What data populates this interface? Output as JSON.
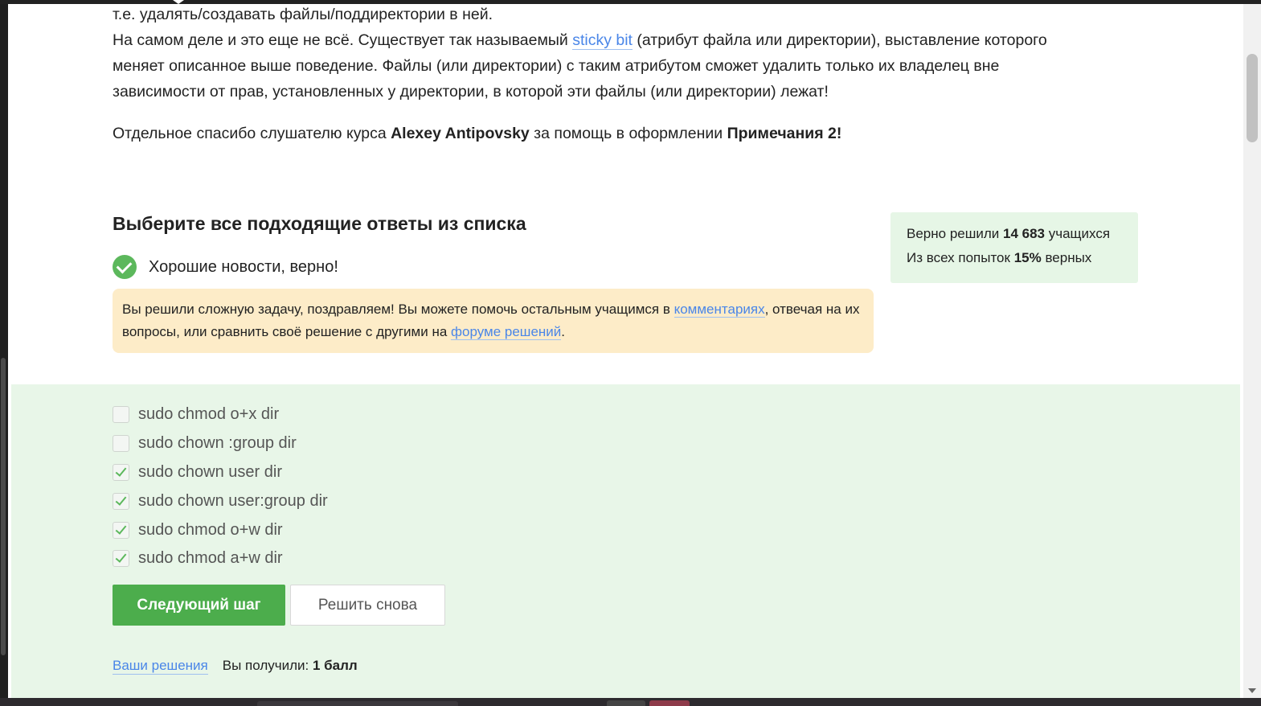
{
  "content": {
    "para1_line1": "т.е. удалять/создавать файлы/поддиректории в ней.",
    "para1_line2_before": "На самом деле и это еще не всё. Существует так называемый ",
    "sticky_bit_link": "sticky bit",
    "para1_line2_after": " (атрибут файла или директории), выставление которого",
    "para1_line3": "меняет описанное выше поведение. Файлы (или директории) с таким атрибутом сможет удалить только их владелец вне",
    "para1_line4": "зависимости от прав, установленных у директории, в которой эти файлы (или директории) лежат!",
    "thanks_before": "Отдельное спасибо слушателю курса ",
    "thanks_name": "Alexey Antipovsky",
    "thanks_middle": " за помощь в оформлении ",
    "thanks_note": "Примечания 2!"
  },
  "quiz": {
    "title": "Выберите все подходящие ответы из списка",
    "good_news": "Хорошие новости, верно!",
    "notice_before": "Вы решили сложную задачу, поздравляем! Вы можете помочь остальным учащимся в ",
    "notice_link_comments": "комментариях",
    "notice_middle": ", отвечая на их вопросы, или сравнить своё решение с другими на ",
    "notice_link_forum": "форуме решений",
    "notice_end": ".",
    "options": [
      {
        "label": "sudo chmod o+x dir",
        "checked": false
      },
      {
        "label": "sudo chown :group dir",
        "checked": false
      },
      {
        "label": "sudo chown user dir",
        "checked": true
      },
      {
        "label": "sudo chown user:group dir",
        "checked": true
      },
      {
        "label": "sudo chmod o+w dir",
        "checked": true
      },
      {
        "label": "sudo chmod a+w dir",
        "checked": true
      }
    ],
    "next_button": "Следующий шаг",
    "retry_button": "Решить снова",
    "your_solutions_link": "Ваши решения",
    "score_label": "Вы получили: ",
    "score_value": "1 балл"
  },
  "stats": {
    "solved_label": "Верно решили ",
    "solved_count": "14 683",
    "solved_suffix": " учащихся",
    "attempts_label": "Из всех попыток ",
    "attempts_percent": "15%",
    "attempts_suffix": " верных"
  }
}
